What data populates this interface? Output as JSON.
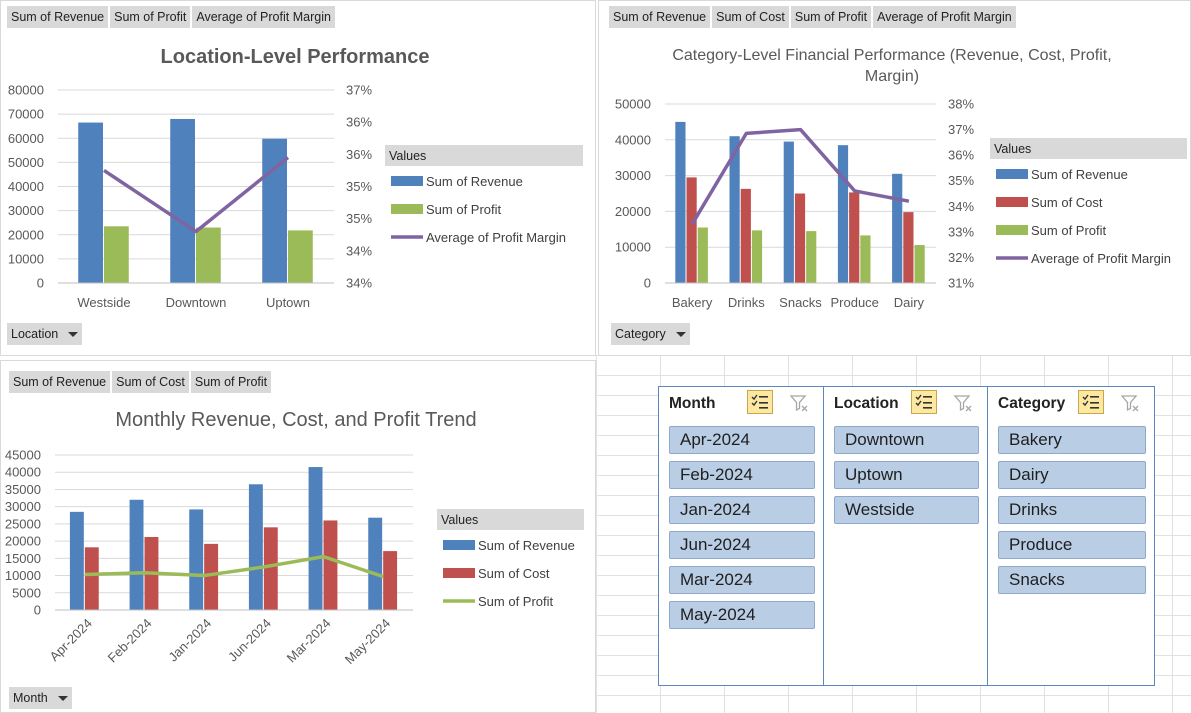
{
  "colors": {
    "revenue": "#4f81bd",
    "cost": "#c0504d",
    "profit": "#9bbb59",
    "margin": "#8064a2",
    "slicer_item": "#b9cde5"
  },
  "chart1": {
    "field_buttons": [
      "Sum of Revenue",
      "Sum of Profit",
      "Average of Profit Margin"
    ],
    "axis_button": "Location",
    "legend_title": "Values",
    "legend": [
      "Sum of Revenue",
      "Sum of Profit",
      "Average of Profit Margin"
    ]
  },
  "chart2": {
    "field_buttons": [
      "Sum of Revenue",
      "Sum of Cost",
      "Sum of Profit",
      "Average of Profit Margin"
    ],
    "axis_button": "Category",
    "legend_title": "Values",
    "legend": [
      "Sum of Revenue",
      "Sum of Cost",
      "Sum of Profit",
      "Average of Profit Margin"
    ]
  },
  "chart3": {
    "field_buttons": [
      "Sum of Revenue",
      "Sum of Cost",
      "Sum of Profit"
    ],
    "axis_button": "Month",
    "legend_title": "Values",
    "legend": [
      "Sum of Revenue",
      "Sum of Cost",
      "Sum of Profit"
    ]
  },
  "chart_data": [
    {
      "type": "bar",
      "title": "Location-Level Performance",
      "categories": [
        "Westside",
        "Downtown",
        "Uptown"
      ],
      "series": [
        {
          "name": "Sum of Revenue",
          "type": "bar",
          "axis": "primary",
          "values": [
            66500,
            68000,
            59800
          ]
        },
        {
          "name": "Sum of Profit",
          "type": "bar",
          "axis": "primary",
          "values": [
            23500,
            23000,
            21800
          ]
        },
        {
          "name": "Average of Profit Margin",
          "type": "line",
          "axis": "secondary",
          "values": [
            0.3575,
            0.348,
            0.3595
          ]
        }
      ],
      "ylim": [
        0,
        80000
      ],
      "yticks": [
        "0",
        "10000",
        "20000",
        "30000",
        "40000",
        "50000",
        "60000",
        "70000",
        "80000"
      ],
      "y2lim": [
        0.34,
        0.37
      ],
      "y2ticks": [
        "34%",
        "34%",
        "35%",
        "35%",
        "36%",
        "36%",
        "37%"
      ]
    },
    {
      "type": "bar",
      "title": "Category-Level Financial Performance (Revenue, Cost, Profit, Margin)",
      "categories": [
        "Bakery",
        "Drinks",
        "Snacks",
        "Produce",
        "Dairy"
      ],
      "series": [
        {
          "name": "Sum of Revenue",
          "type": "bar",
          "axis": "primary",
          "values": [
            45000,
            41000,
            39500,
            38500,
            30500
          ]
        },
        {
          "name": "Sum of Cost",
          "type": "bar",
          "axis": "primary",
          "values": [
            29500,
            26300,
            25000,
            25300,
            19800
          ]
        },
        {
          "name": "Sum of Profit",
          "type": "bar",
          "axis": "primary",
          "values": [
            15500,
            14700,
            14500,
            13300,
            10600
          ]
        },
        {
          "name": "Average of Profit Margin",
          "type": "line",
          "axis": "secondary",
          "values": [
            0.333,
            0.3685,
            0.37,
            0.346,
            0.342
          ]
        }
      ],
      "ylim": [
        0,
        50000
      ],
      "yticks": [
        "0",
        "10000",
        "20000",
        "30000",
        "40000",
        "50000"
      ],
      "y2lim": [
        0.31,
        0.38
      ],
      "y2ticks": [
        "31%",
        "32%",
        "33%",
        "34%",
        "35%",
        "36%",
        "37%",
        "38%"
      ]
    },
    {
      "type": "bar",
      "title": "Monthly Revenue, Cost, and Profit Trend",
      "categories": [
        "Apr-2024",
        "Feb-2024",
        "Jan-2024",
        "Jun-2024",
        "Mar-2024",
        "May-2024"
      ],
      "series": [
        {
          "name": "Sum of Revenue",
          "type": "bar",
          "axis": "primary",
          "values": [
            28500,
            32000,
            29200,
            36500,
            41500,
            26800
          ]
        },
        {
          "name": "Sum of Cost",
          "type": "bar",
          "axis": "primary",
          "values": [
            18200,
            21200,
            19200,
            24000,
            26000,
            17100
          ]
        },
        {
          "name": "Sum of Profit",
          "type": "line",
          "axis": "primary",
          "values": [
            10300,
            10800,
            10000,
            12500,
            15500,
            9700
          ]
        }
      ],
      "ylim": [
        0,
        45000
      ],
      "yticks": [
        "0",
        "5000",
        "10000",
        "15000",
        "20000",
        "25000",
        "30000",
        "35000",
        "40000",
        "45000"
      ]
    }
  ],
  "slicers": [
    {
      "title": "Month",
      "items": [
        "Apr-2024",
        "Feb-2024",
        "Jan-2024",
        "Jun-2024",
        "Mar-2024",
        "May-2024"
      ]
    },
    {
      "title": "Location",
      "items": [
        "Downtown",
        "Uptown",
        "Westside"
      ]
    },
    {
      "title": "Category",
      "items": [
        "Bakery",
        "Dairy",
        "Drinks",
        "Produce",
        "Snacks"
      ]
    }
  ]
}
